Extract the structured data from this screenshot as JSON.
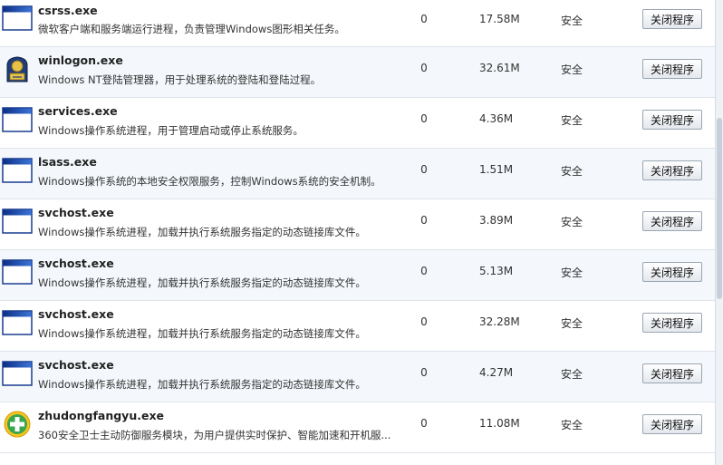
{
  "processes": [
    {
      "name": "csrss.exe",
      "description": "微软客户端和服务端运行进程，负责管理Windows图形相关任务。",
      "count": "0",
      "memory": "17.58M",
      "status": "安全",
      "action": "关闭程序",
      "icon": "window-icon"
    },
    {
      "name": "winlogon.exe",
      "description": "Windows NT登陆管理器，用于处理系统的登陆和登陆过程。",
      "count": "0",
      "memory": "32.61M",
      "status": "安全",
      "action": "关闭程序",
      "icon": "winlogon-icon"
    },
    {
      "name": "services.exe",
      "description": "Windows操作系统进程，用于管理启动或停止系统服务。",
      "count": "0",
      "memory": "4.36M",
      "status": "安全",
      "action": "关闭程序",
      "icon": "window-icon"
    },
    {
      "name": "lsass.exe",
      "description": "Windows操作系统的本地安全权限服务，控制Windows系统的安全机制。",
      "count": "0",
      "memory": "1.51M",
      "status": "安全",
      "action": "关闭程序",
      "icon": "window-icon"
    },
    {
      "name": "svchost.exe",
      "description": "Windows操作系统进程，加载并执行系统服务指定的动态链接库文件。",
      "count": "0",
      "memory": "3.89M",
      "status": "安全",
      "action": "关闭程序",
      "icon": "window-icon"
    },
    {
      "name": "svchost.exe",
      "description": "Windows操作系统进程，加载并执行系统服务指定的动态链接库文件。",
      "count": "0",
      "memory": "5.13M",
      "status": "安全",
      "action": "关闭程序",
      "icon": "window-icon"
    },
    {
      "name": "svchost.exe",
      "description": "Windows操作系统进程，加载并执行系统服务指定的动态链接库文件。",
      "count": "0",
      "memory": "32.28M",
      "status": "安全",
      "action": "关闭程序",
      "icon": "window-icon"
    },
    {
      "name": "svchost.exe",
      "description": "Windows操作系统进程，加载并执行系统服务指定的动态链接库文件。",
      "count": "0",
      "memory": "4.27M",
      "status": "安全",
      "action": "关闭程序",
      "icon": "window-icon"
    },
    {
      "name": "zhudongfangyu.exe",
      "description": "360安全卫士主动防御服务模块，为用户提供实时保护、智能加速和开机服...",
      "count": "0",
      "memory": "11.08M",
      "status": "安全",
      "action": "关闭程序",
      "icon": "360-plus-icon"
    }
  ],
  "colors": {
    "row_alt": "#f4f8fc",
    "window_title": "#1f4fa8",
    "plus_green": "#3aa64c",
    "plus_yellow": "#f7c51e"
  }
}
